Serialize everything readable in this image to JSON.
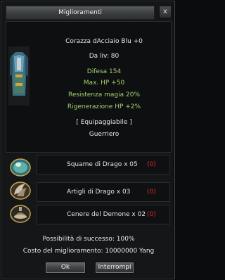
{
  "window": {
    "title": "Miglioramenti",
    "close_glyph": "x"
  },
  "item": {
    "name": "Corazza dAcciaio Blu +0",
    "level": "Da liv: 80",
    "stats": [
      "Difesa 154",
      "Max. HP +50",
      "Resistenza magia 20%",
      "Rigenerazione HP +2%"
    ],
    "equip": "[ Equipaggiabile ]",
    "class": "Guerriero",
    "icon": "blue-steel-armor-icon"
  },
  "materials": [
    {
      "name": "Squame di Drago x 05",
      "have": "(0)",
      "icon": "dragon-scale-icon"
    },
    {
      "name": "Artigli di Drago x 03",
      "have": "(0)",
      "icon": "dragon-claw-icon"
    },
    {
      "name": "Cenere del Demone x 02",
      "have": "(0)",
      "icon": "demon-ash-icon"
    }
  ],
  "success": "Possibilità di successo: 100%",
  "cost": "Costo del miglioramento: 10000000 Yang",
  "buttons": {
    "ok": "Ok",
    "cancel": "Interrompi"
  },
  "colors": {
    "stat_green": "#a4d26e",
    "missing_red": "#e02a2a"
  }
}
